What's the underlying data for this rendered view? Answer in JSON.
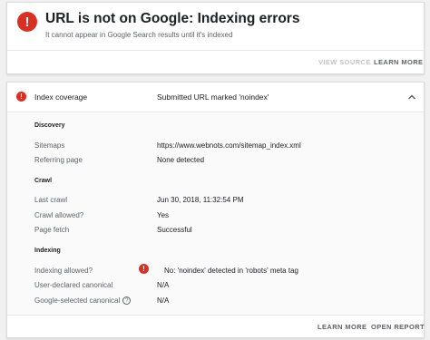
{
  "header_card": {
    "title": "URL is not on Google: Indexing errors",
    "subtitle": "It cannot appear in Google Search results until it's indexed",
    "error_icon_glyph": "!",
    "view_source_label": "VIEW SOURCE",
    "learn_more_label": "LEARN MORE"
  },
  "coverage_card": {
    "label": "Index coverage",
    "status": "Submitted URL marked 'noindex'",
    "error_icon_glyph": "!",
    "expanded": true,
    "sections": {
      "discovery": {
        "title": "Discovery",
        "rows": [
          {
            "label": "Sitemaps",
            "value": "https://www.webnots.com/sitemap_index.xml"
          },
          {
            "label": "Referring page",
            "value": "None detected"
          }
        ]
      },
      "crawl": {
        "title": "Crawl",
        "rows": [
          {
            "label": "Last crawl",
            "value": "Jun 30, 2018, 11:32:54 PM"
          },
          {
            "label": "Crawl allowed?",
            "value": "Yes"
          },
          {
            "label": "Page fetch",
            "value": "Successful"
          }
        ]
      },
      "indexing": {
        "title": "Indexing",
        "rows": [
          {
            "label": "Indexing allowed?",
            "value": "No: 'noindex' detected in 'robots' meta tag"
          },
          {
            "label": "User-declared canonical",
            "value": "N/A"
          },
          {
            "label": "Google-selected canonical",
            "value": "N/A"
          }
        ]
      }
    },
    "help_icon_glyph": "?",
    "learn_more_label": "LEARN MORE",
    "open_report_label": "OPEN REPORT"
  },
  "colors": {
    "error": "#d93025",
    "page_background": "#f1f1f1",
    "details_background": "#fafafa",
    "button_text": "#5f6368",
    "disabled_button_text": "#c4c4c4"
  },
  "icons": {
    "error": "error-icon",
    "expand": "chevron-up-icon",
    "help": "help-icon"
  }
}
